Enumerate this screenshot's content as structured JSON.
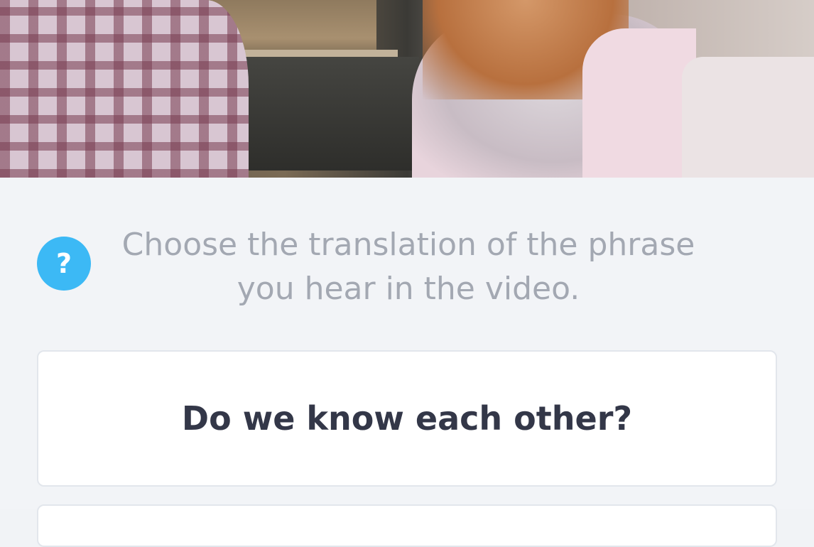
{
  "video": {
    "description_icon": "video-frame"
  },
  "question": {
    "help_icon_glyph": "?",
    "instruction_line1": "Choose the translation of the phrase",
    "instruction_line2": "you hear in the video."
  },
  "options": [
    {
      "label": "Do we know each other?"
    },
    {
      "label": ""
    }
  ],
  "colors": {
    "accent": "#3cb9f5",
    "instruction_text": "#a3a8b2",
    "option_text": "#333748",
    "panel_bg": "#f2f4f7"
  }
}
